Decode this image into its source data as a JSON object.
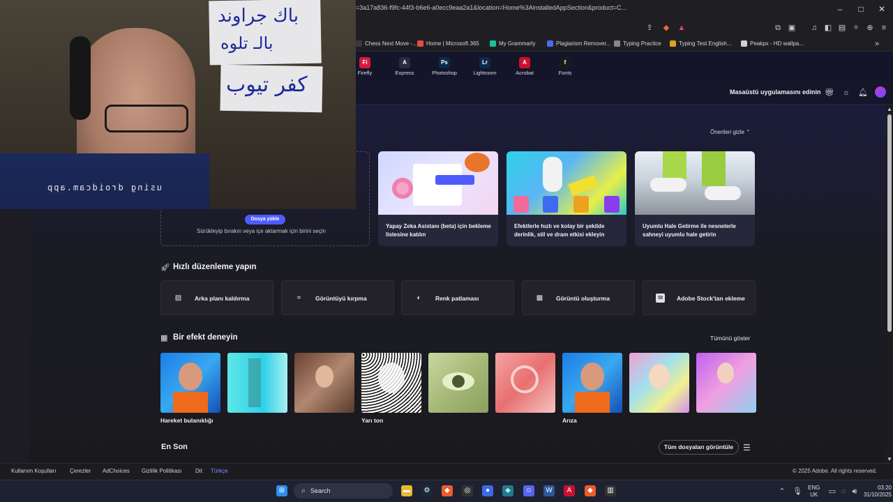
{
  "browser": {
    "url": "=3a17a836-f9fc-44f3-b6e6-a0ecc9eaa2a1&location=Home%3AinstalledAppSection&product=C...",
    "bookmarks": [
      {
        "label": "Chess Next Move -...",
        "color": "#3a3a3a"
      },
      {
        "label": "Home | Microsoft 365",
        "color": "#e74c3c"
      },
      {
        "label": "My Grammarly",
        "color": "#15c39a"
      },
      {
        "label": "Plagiarism Remover...",
        "color": "#4a6cf0"
      },
      {
        "label": "Typing Practice",
        "color": "#888888"
      },
      {
        "label": "Typing Test English...",
        "color": "#e0a020"
      },
      {
        "label": "Peakpx - HD wallpa...",
        "color": "#d0d0d0"
      }
    ]
  },
  "apps": [
    {
      "abbr": "Fi",
      "label": "Firefly",
      "color": "#d7193f"
    },
    {
      "abbr": "A",
      "label": "Express",
      "color": "#2a2a40"
    },
    {
      "abbr": "Ps",
      "label": "Photoshop",
      "color": "#0a2a4a"
    },
    {
      "abbr": "Lr",
      "label": "Lightroom",
      "color": "#0a2a4a"
    },
    {
      "abbr": "A",
      "label": "Acrobat",
      "color": "#c8102e"
    },
    {
      "abbr": "f",
      "label": "Fonts",
      "color": "#1a1a1a"
    }
  ],
  "header": {
    "cta": "Masaüstü uygulamasını edinin"
  },
  "recommendations": {
    "hide_label": "Önerileri gizle",
    "upload_button": "Dosya yükle",
    "upload_hint": "Sürükleyip bırakın veya içe aktarmak için birini seçin",
    "cards": [
      {
        "text": "Yapay Zeka Asistanı (beta) için bekleme listesine katılın"
      },
      {
        "text": "Efektlerle hızlı ve kolay bir şekilde derinlik, stil ve dram etkisi ekleyin"
      },
      {
        "text": "Uyumlu Hale Getirme ile nesnelerle sahneyi uyumlu hale getirin"
      }
    ]
  },
  "quick_edit": {
    "title": "Hızlı düzenleme yapın",
    "actions": [
      {
        "label": "Arka planı kaldırma",
        "icon": "image-icon"
      },
      {
        "label": "Görüntüyü kırpma",
        "icon": "crop-icon"
      },
      {
        "label": "Renk patlaması",
        "icon": "color-pop-icon"
      },
      {
        "label": "Görüntü oluşturma",
        "icon": "generate-image-icon"
      },
      {
        "label": "Adobe Stock'tan ekleme",
        "icon": "stock-icon"
      }
    ]
  },
  "effects": {
    "title": "Bir efekt deneyin",
    "show_all": "Tümünü göster",
    "items": [
      {
        "label": "Hareket bulanıklığı"
      },
      {
        "label": ""
      },
      {
        "label": ""
      },
      {
        "label": "Yarı ton"
      },
      {
        "label": ""
      },
      {
        "label": ""
      },
      {
        "label": "Arıza"
      },
      {
        "label": ""
      },
      {
        "label": ""
      }
    ]
  },
  "recent": {
    "title": "En Son",
    "view_all": "Tüm dosyaları görüntüle"
  },
  "footer": {
    "links": [
      "Kullanım Koşulları",
      "Çerezler",
      "AdChoices",
      "Gizlilik Politikası"
    ],
    "lang_label": "Dil:",
    "lang_value": "Türkçe",
    "copyright": "© 2025 Adobe. All rights reserved."
  },
  "taskbar": {
    "search": "Search",
    "lang_top": "ENG",
    "lang_bottom": "UK",
    "time": "03:20",
    "date": "31/10/2025"
  },
  "webcam": {
    "sign_top": "باك جراوند",
    "sign_top2": "بالـ تلوه",
    "sign_bottom": "كفر تيوب",
    "overlay": "using droidcam.app"
  }
}
